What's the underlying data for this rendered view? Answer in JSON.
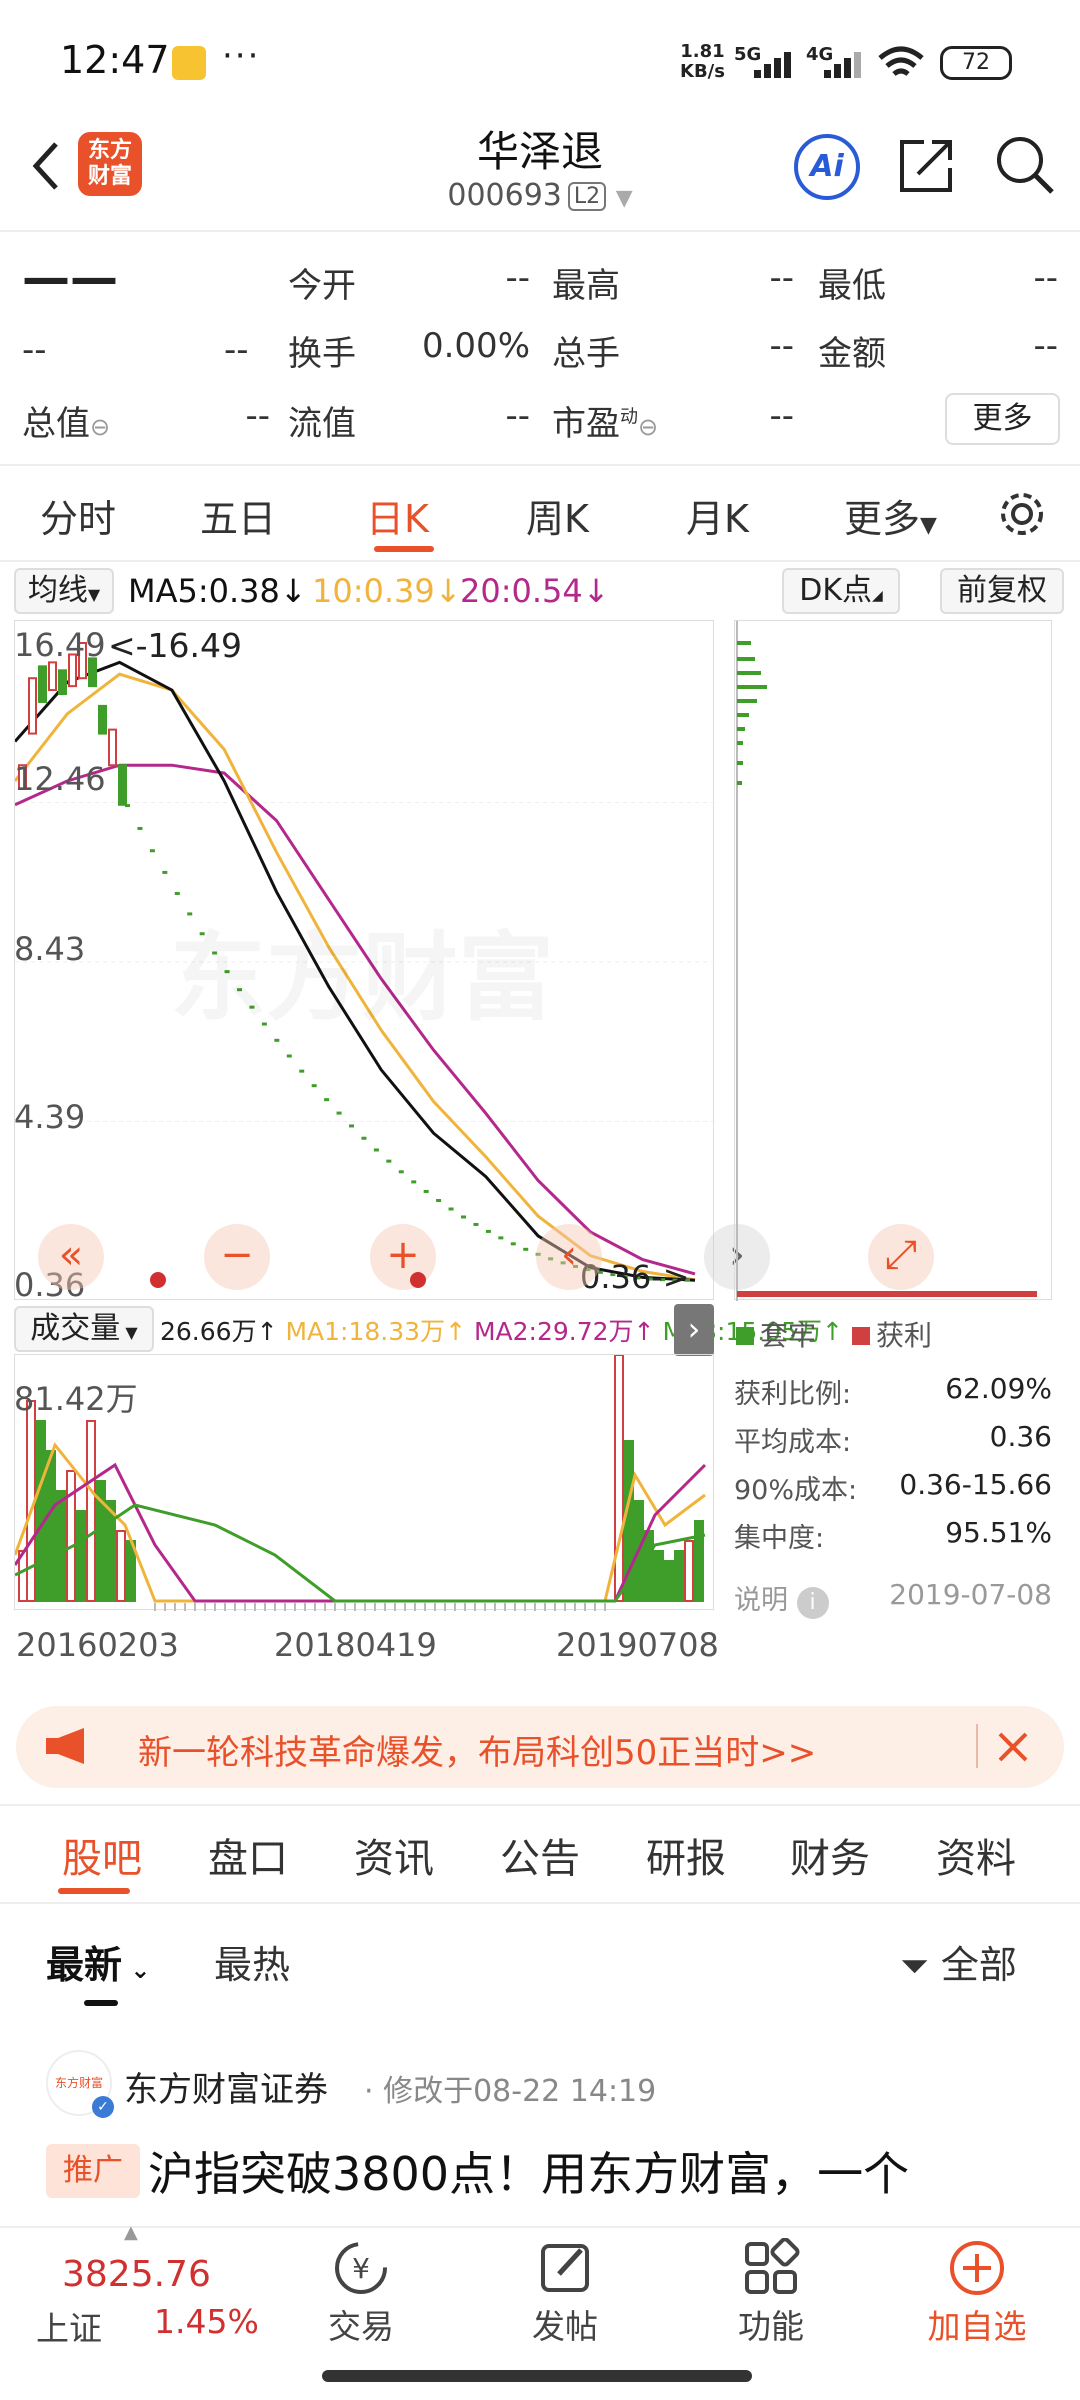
{
  "status_bar": {
    "time": "12:47",
    "more_dots": "···",
    "net_speed_value": "1.81",
    "net_speed_unit": "KB/s",
    "sig1": "5G",
    "sig2": "4G",
    "battery": "72"
  },
  "header": {
    "logo_text": "东方财富",
    "stock_name": "华泽退",
    "stock_code": "000693",
    "level_badge": "L2",
    "ai_label": "Ai"
  },
  "quote": {
    "price": "——",
    "change": "--",
    "change_pct": "--",
    "rows": [
      [
        {
          "label": "今开",
          "value": "--"
        },
        {
          "label": "最高",
          "value": "--"
        },
        {
          "label": "最低",
          "value": "--"
        }
      ],
      [
        {
          "label": "换手",
          "value": "0.00%"
        },
        {
          "label": "总手",
          "value": "--"
        },
        {
          "label": "金额",
          "value": "--"
        }
      ]
    ],
    "row3": [
      {
        "label": "总值",
        "value": "--"
      },
      {
        "label": "流值",
        "value": "--"
      },
      {
        "label": "市盈",
        "sup": "动",
        "value": "--"
      }
    ],
    "more_button": "更多"
  },
  "ktabs": [
    "分时",
    "五日",
    "日K",
    "周K",
    "月K",
    "更多"
  ],
  "ma_bar": {
    "selector": "均线",
    "ma5": "MA5:0.38",
    "ma10": "10:0.39",
    "ma20": "20:0.54",
    "arrow": "↓",
    "dk_selector": "DK点",
    "adjust": "前复权"
  },
  "colors": {
    "accent": "#e8512a",
    "ma5": "#111111",
    "ma10": "#f0b43c",
    "ma20": "#b4288c",
    "up": "#d04040",
    "down": "#3f9d2a"
  },
  "chart_data": [
    {
      "type": "candlestick",
      "y_ticks": [
        "16.49",
        "12.46",
        "8.43",
        "4.39",
        "0.36"
      ],
      "ylim": [
        0.36,
        16.49
      ],
      "annotations": [
        "<-16.49",
        "0.36->"
      ],
      "x_ticks": [
        "20160203",
        "20180419",
        "20190708"
      ],
      "ma5_values": [
        14.0,
        15.5,
        16.0,
        15.3,
        13.0,
        10.2,
        7.8,
        5.7,
        4.1,
        3.0,
        1.5,
        0.7,
        0.45,
        0.38
      ],
      "ma10_values": [
        13.0,
        14.7,
        15.7,
        15.3,
        13.8,
        11.2,
        8.8,
        6.7,
        4.9,
        3.5,
        2.0,
        1.0,
        0.6,
        0.39
      ],
      "ma20_values": [
        12.4,
        13.0,
        13.4,
        13.4,
        13.2,
        12.0,
        10.0,
        8.0,
        6.2,
        4.6,
        2.9,
        1.6,
        0.9,
        0.54
      ]
    },
    {
      "type": "bar",
      "title": "成交量",
      "value_label": "26.66万",
      "ma1": "MA1:18.33万",
      "ma2": "MA2:29.72万",
      "ma3": "MA3:15.05万",
      "max_label": "81.42万"
    }
  ],
  "chip_panel": {
    "legend_trapped": "套牢",
    "legend_profit": "获利",
    "stats": [
      {
        "label": "获利比例:",
        "value": "62.09%"
      },
      {
        "label": "平均成本:",
        "value": "0.36"
      },
      {
        "label": "90%成本:",
        "value": "0.36-15.66"
      },
      {
        "label": "集中度:",
        "value": "95.51%"
      }
    ],
    "note_label": "说明",
    "date": "2019-07-08"
  },
  "banner": {
    "text": "新一轮科技革命爆发，布局科创50正当时>>"
  },
  "bottom_tabs": [
    "股吧",
    "盘口",
    "资讯",
    "公告",
    "研报",
    "财务",
    "资料"
  ],
  "feed": {
    "sort_latest": "最新",
    "sort_hot": "最热",
    "filter": "全部",
    "post": {
      "author": "东方财富证券",
      "meta": "· 修改于08-22 14:19",
      "tag": "推广",
      "title": "沪指突破3800点！用东方财富，一个"
    }
  },
  "bottom_nav": {
    "index_value": "3825.76",
    "index_name": "上证",
    "index_change": "1.45%",
    "items": [
      "交易",
      "发帖",
      "功能",
      "加自选"
    ]
  }
}
